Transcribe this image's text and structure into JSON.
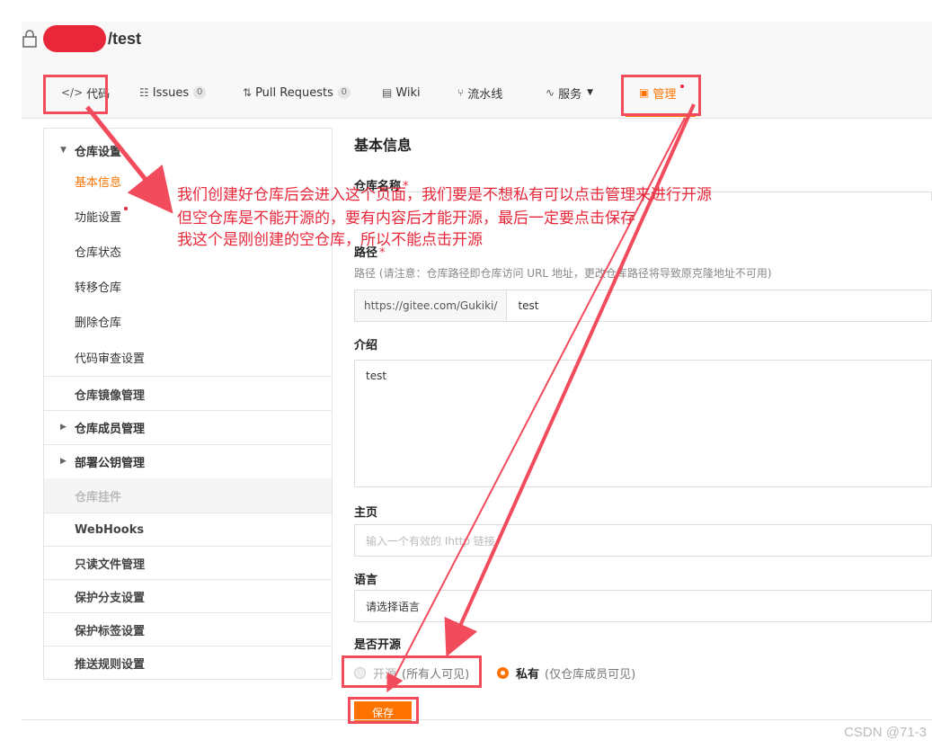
{
  "repo": {
    "name": "/test"
  },
  "nav": {
    "code": "代码",
    "issues": "Issues",
    "issues_count": "0",
    "pull_requests": "Pull Requests",
    "pull_requests_count": "0",
    "wiki": "Wiki",
    "pipeline": "流水线",
    "services": "服务",
    "manage": "管理"
  },
  "sidebar": {
    "repo_settings": "仓库设置",
    "basic_info": "基本信息",
    "features": "功能设置",
    "repo_status": "仓库状态",
    "transfer": "转移仓库",
    "delete": "删除仓库",
    "code_review": "代码审查设置",
    "mirror": "仓库镜像管理",
    "members": "仓库成员管理",
    "deploy_keys": "部署公钥管理",
    "plugins": "仓库挂件",
    "webhooks": "WebHooks",
    "readonly_files": "只读文件管理",
    "protected_branches": "保护分支设置",
    "protected_tags": "保护标签设置",
    "push_rules": "推送规则设置"
  },
  "form": {
    "section_title": "基本信息",
    "name_label": "仓库名称",
    "path_label": "路径",
    "path_hint": "路径 (请注意：仓库路径即仓库访问 URL 地址，更改仓库路径将导致原克隆地址不可用)",
    "path_prefix": "https://gitee.com/Gukiki/",
    "path_value": "test",
    "intro_label": "介绍",
    "intro_value": "test",
    "homepage_label": "主页",
    "homepage_placeholder": "输入一个有效的 Ihttp 链接",
    "language_label": "语言",
    "language_value": "请选择语言",
    "open_source_label": "是否开源",
    "public_label": "开源",
    "public_sub": "(所有人可见)",
    "private_label": "私有",
    "private_sub": "(仅仓库成员可见)",
    "save": "保存",
    "required_mark": "*"
  },
  "annotation": {
    "line1": "我们创建好仓库后会进入这个页面，我们要是不想私有可以点击管理来进行开源",
    "line2": "但空仓库是不能开源的，要有内容后才能开源，最后一定要点击保存",
    "line3": "我这个是刚创建的空仓库，所以不能点击开源"
  },
  "watermark": "CSDN @71-3",
  "colors": {
    "accent": "#fe7300",
    "annotation": "#e8283a"
  }
}
